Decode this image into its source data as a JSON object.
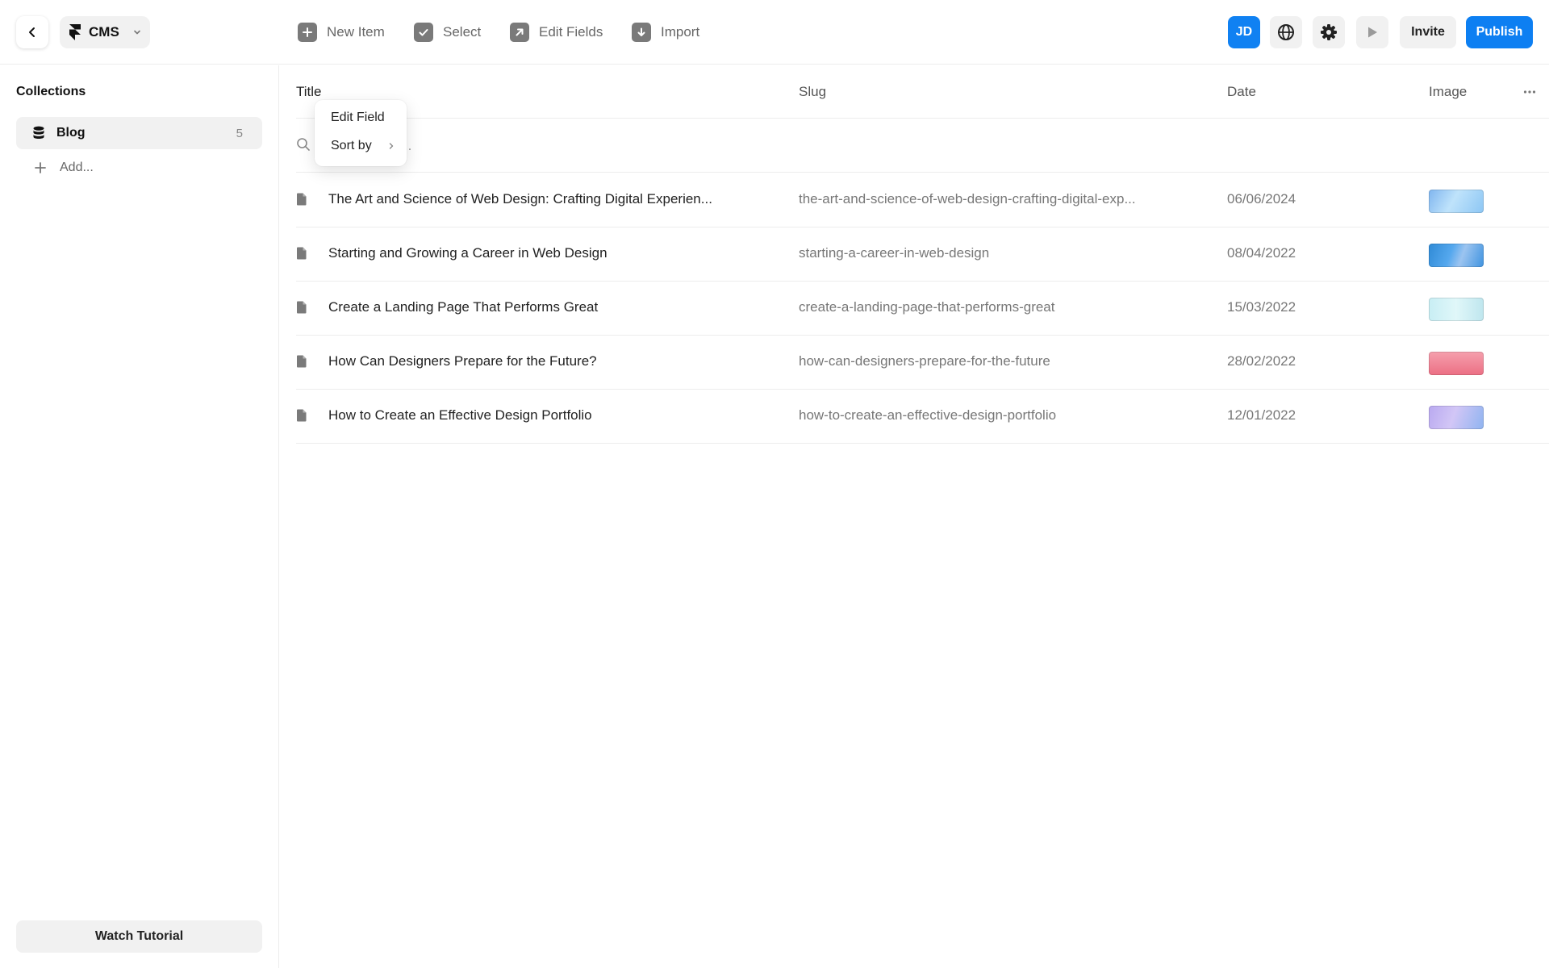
{
  "topbar": {
    "project_label": "CMS",
    "tools": {
      "new_item": "New Item",
      "select": "Select",
      "edit_fields": "Edit Fields",
      "import": "Import"
    },
    "avatar_initials": "JD",
    "invite_label": "Invite",
    "publish_label": "Publish",
    "colors": {
      "accent": "#0d7ff2",
      "avatar": "#1081f2"
    }
  },
  "sidebar": {
    "heading": "Collections",
    "collections": [
      {
        "name": "Blog",
        "count": "5"
      }
    ],
    "add_label": "Add...",
    "watch_tutorial_label": "Watch Tutorial"
  },
  "table": {
    "columns": {
      "title": "Title",
      "slug": "Slug",
      "date": "Date",
      "image": "Image"
    },
    "search_placeholder": "Search items...",
    "rows": [
      {
        "title": "The Art and Science of Web Design: Crafting Digital Experien...",
        "slug": "the-art-and-science-of-web-design-crafting-digital-exp...",
        "date": "06/06/2024"
      },
      {
        "title": "Starting and Growing a Career in Web Design",
        "slug": "starting-a-career-in-web-design",
        "date": "08/04/2022"
      },
      {
        "title": "Create a Landing Page That Performs Great",
        "slug": "create-a-landing-page-that-performs-great",
        "date": "15/03/2022"
      },
      {
        "title": "How Can Designers Prepare for the Future?",
        "slug": "how-can-designers-prepare-for-the-future",
        "date": "28/02/2022"
      },
      {
        "title": "How to Create an Effective Design Portfolio",
        "slug": "how-to-create-an-effective-design-portfolio",
        "date": "12/01/2022"
      }
    ]
  },
  "context_menu": {
    "items": [
      {
        "label": "Edit Field"
      },
      {
        "label": "Sort by"
      }
    ]
  },
  "icons": {
    "back": "chevron-left-icon",
    "project": "framer-logo-icon",
    "new_item": "plus-icon",
    "select": "check-icon",
    "edit_fields": "arrow-up-right-icon",
    "import": "arrow-down-icon",
    "language": "globe-icon",
    "settings": "gear-icon",
    "preview": "play-icon",
    "collection": "database-icon",
    "add": "plus-icon",
    "more": "more-horizontal-icon",
    "search": "search-icon",
    "row": "document-icon"
  }
}
